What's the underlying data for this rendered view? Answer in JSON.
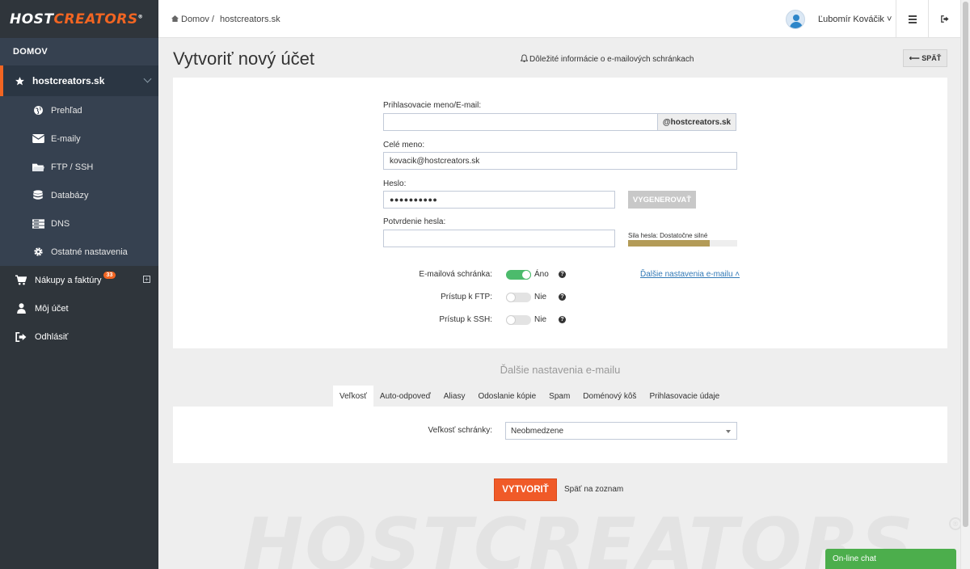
{
  "brand": {
    "logo_white": "HOST",
    "logo_orange": "CREATORS",
    "logo_mark": "®"
  },
  "sidebar": {
    "section": "DOMOV",
    "domain": "hostcreators.sk",
    "sub_items": [
      {
        "label": "Prehľad",
        "icon": "globe-icon"
      },
      {
        "label": "E-maily",
        "icon": "envelope-icon"
      },
      {
        "label": "FTP / SSH",
        "icon": "folder-icon"
      },
      {
        "label": "Databázy",
        "icon": "database-icon"
      },
      {
        "label": "DNS",
        "icon": "server-icon"
      },
      {
        "label": "Ostatné nastavenia",
        "icon": "gear-icon"
      }
    ],
    "items": [
      {
        "label": "Nákupy a faktúry",
        "icon": "cart-icon",
        "badge": "33"
      },
      {
        "label": "Môj účet",
        "icon": "user-icon"
      },
      {
        "label": "Odhlásiť",
        "icon": "logout-icon"
      }
    ]
  },
  "header": {
    "breadcrumb_home": "Domov /",
    "breadcrumb_current": "hostcreators.sk",
    "user_name": "Ľubomír Kováčik ˅"
  },
  "page": {
    "title": "Vytvoriť nový účet",
    "info_link": "Dôležité informácie o e-mailových schránkach",
    "back_button": "⟵  SPÄŤ"
  },
  "form": {
    "login_label": "Prihlasovacie meno/E-mail:",
    "login_value": "",
    "domain_suffix": "@hostcreators.sk",
    "fullname_label": "Celé meno:",
    "fullname_value": "kovacik@hostcreators.sk",
    "password_label": "Heslo:",
    "password_value": "●●●●●●●●●●",
    "generate_button": "VYGENEROVAŤ",
    "confirm_label": "Potvrdenie hesla:",
    "confirm_value": "",
    "strength_label": "Sila hesla: Dostatočne silné",
    "strength_fraction": 0.75
  },
  "toggles": [
    {
      "label": "E-mailová schránka:",
      "value": "Áno",
      "on": true
    },
    {
      "label": "Prístup k FTP:",
      "value": "Nie",
      "on": false
    },
    {
      "label": "Prístup k SSH:",
      "value": "Nie",
      "on": false
    }
  ],
  "more_settings_link": "Ďalšie nastavenia e-mailu ˄",
  "more_settings": {
    "title": "Ďalšie nastavenia e-mailu",
    "tabs": [
      "Veľkosť",
      "Auto-odpoveď",
      "Aliasy",
      "Odoslanie kópie",
      "Spam",
      "Doménový kôš",
      "Prihlasovacie údaje"
    ],
    "active_tab": "Veľkosť",
    "size_label": "Veľkosť schránky:",
    "size_value": "Neobmedzene"
  },
  "actions": {
    "create": "VYTVORIŤ",
    "back_to_list": "Späť na zoznam"
  },
  "watermark": "HOSTCREATORS",
  "chat": "On-line chat",
  "colors": {
    "accent": "#f26522",
    "sidebar": "#2f353b",
    "toggle_on": "#4cbb6c",
    "chat": "#4cae4c",
    "strength": "#b39b57"
  }
}
